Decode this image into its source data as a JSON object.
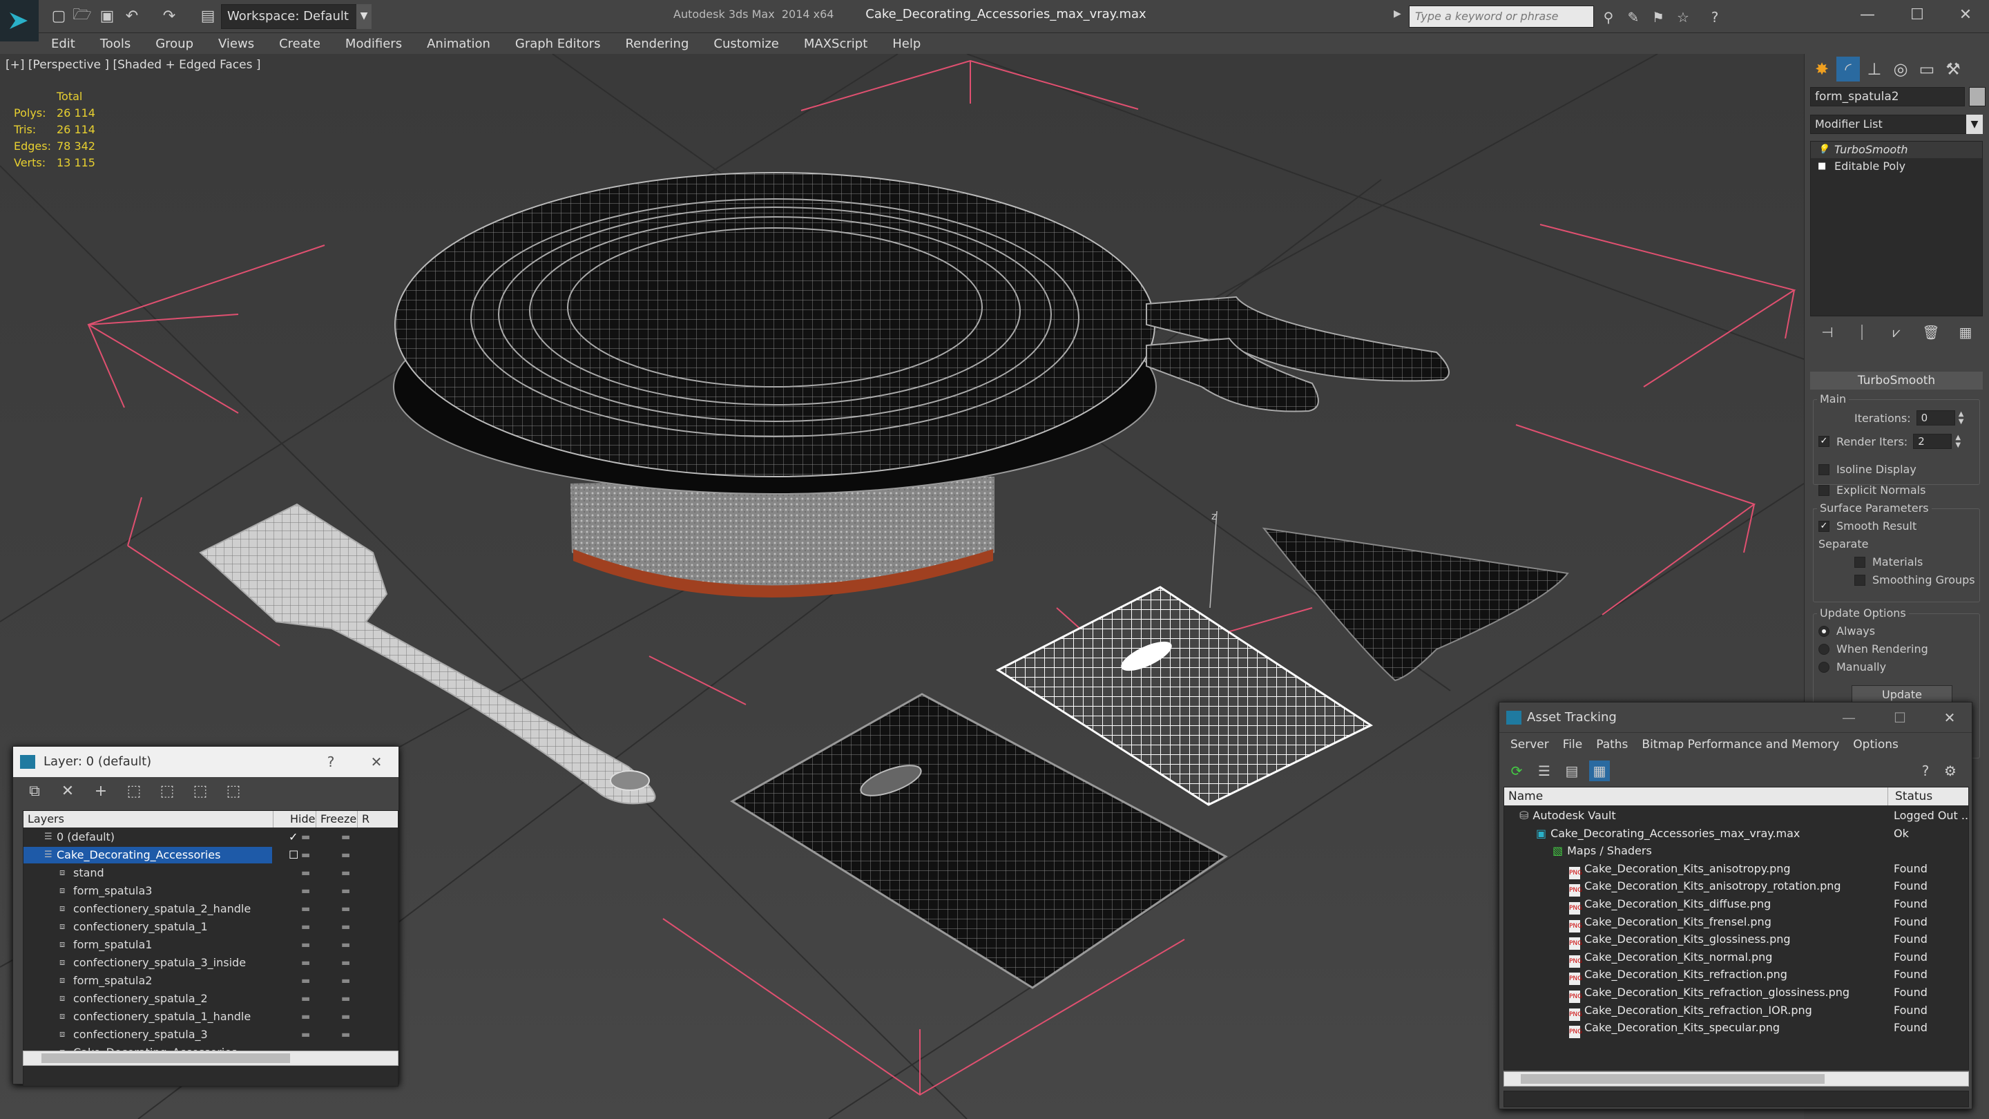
{
  "app": {
    "title": "Autodesk 3ds Max  2014 x64",
    "file": "Cake_Decorating_Accessories_max_vray.max",
    "workspace": "Workspace: Default",
    "search_placeholder": "Type a keyword or phrase"
  },
  "menu": [
    "Edit",
    "Tools",
    "Group",
    "Views",
    "Create",
    "Modifiers",
    "Animation",
    "Graph Editors",
    "Rendering",
    "Customize",
    "MAXScript",
    "Help"
  ],
  "viewport": {
    "label": "[+] [Perspective ] [Shaded + Edged Faces ]",
    "stats": {
      "header": "Total",
      "rows": [
        {
          "label": "Polys:",
          "value": "26 114"
        },
        {
          "label": "Tris:",
          "value": "26 114"
        },
        {
          "label": "Edges:",
          "value": "78 342"
        },
        {
          "label": "Verts:",
          "value": "13 115"
        }
      ]
    },
    "axis_label": "z"
  },
  "command_panel": {
    "object_name": "form_spatula2",
    "modifier_list": "Modifier List",
    "stack": [
      {
        "label": "TurboSmooth",
        "selected": true
      },
      {
        "label": "Editable Poly",
        "selected": false
      }
    ],
    "turbosmooth": {
      "title": "TurboSmooth",
      "main_label": "Main",
      "iterations_label": "Iterations:",
      "iterations_value": "0",
      "render_iters_label": "Render Iters:",
      "render_iters_value": "2",
      "isoline_label": "Isoline Display",
      "explicit_normals_label": "Explicit Normals",
      "surface_params_label": "Surface Parameters",
      "smooth_result_label": "Smooth Result",
      "separate_label": "Separate",
      "materials_label": "Materials",
      "smoothing_groups_label": "Smoothing Groups",
      "update_options_label": "Update Options",
      "always_label": "Always",
      "when_rendering_label": "When Rendering",
      "manually_label": "Manually",
      "update_button": "Update"
    }
  },
  "layer_dialog": {
    "title": "Layer: 0 (default)",
    "help": "?",
    "columns": [
      "Layers",
      "Hide",
      "Freeze",
      "R"
    ],
    "rows": [
      {
        "name": "0 (default)",
        "level": 0,
        "checked": true,
        "selected": false
      },
      {
        "name": "Cake_Decorating_Accessories",
        "level": 0,
        "checked": false,
        "selected": true
      },
      {
        "name": "stand",
        "level": 1
      },
      {
        "name": "form_spatula3",
        "level": 1
      },
      {
        "name": "confectionery_spatula_2_handle",
        "level": 1
      },
      {
        "name": "confectionery_spatula_1",
        "level": 1
      },
      {
        "name": "form_spatula1",
        "level": 1
      },
      {
        "name": "confectionery_spatula_3_inside",
        "level": 1
      },
      {
        "name": "form_spatula2",
        "level": 1
      },
      {
        "name": "confectionery_spatula_2",
        "level": 1
      },
      {
        "name": "confectionery_spatula_1_handle",
        "level": 1
      },
      {
        "name": "confectionery_spatula_3",
        "level": 1
      },
      {
        "name": "Cake_Decorating_Accessories",
        "level": 1
      }
    ]
  },
  "asset_tracking": {
    "title": "Asset Tracking",
    "menu": [
      "Server",
      "File",
      "Paths",
      "Bitmap Performance and Memory",
      "Options"
    ],
    "columns": [
      "Name",
      "Status"
    ],
    "rows": [
      {
        "name": "Autodesk Vault",
        "status": "Logged Out ...",
        "level": 0,
        "kind": "vault"
      },
      {
        "name": "Cake_Decorating_Accessories_max_vray.max",
        "status": "Ok",
        "level": 1,
        "kind": "max"
      },
      {
        "name": "Maps / Shaders",
        "status": "",
        "level": 2,
        "kind": "folder"
      },
      {
        "name": "Cake_Decoration_Kits_anisotropy.png",
        "status": "Found",
        "level": 3,
        "kind": "png"
      },
      {
        "name": "Cake_Decoration_Kits_anisotropy_rotation.png",
        "status": "Found",
        "level": 3,
        "kind": "png"
      },
      {
        "name": "Cake_Decoration_Kits_diffuse.png",
        "status": "Found",
        "level": 3,
        "kind": "png"
      },
      {
        "name": "Cake_Decoration_Kits_frensel.png",
        "status": "Found",
        "level": 3,
        "kind": "png"
      },
      {
        "name": "Cake_Decoration_Kits_glossiness.png",
        "status": "Found",
        "level": 3,
        "kind": "png"
      },
      {
        "name": "Cake_Decoration_Kits_normal.png",
        "status": "Found",
        "level": 3,
        "kind": "png"
      },
      {
        "name": "Cake_Decoration_Kits_refraction.png",
        "status": "Found",
        "level": 3,
        "kind": "png"
      },
      {
        "name": "Cake_Decoration_Kits_refraction_glossiness.png",
        "status": "Found",
        "level": 3,
        "kind": "png"
      },
      {
        "name": "Cake_Decoration_Kits_refraction_IOR.png",
        "status": "Found",
        "level": 3,
        "kind": "png"
      },
      {
        "name": "Cake_Decoration_Kits_specular.png",
        "status": "Found",
        "level": 3,
        "kind": "png"
      }
    ]
  },
  "colors": {
    "stats": "#e8d030",
    "selection": "#1e5aa8",
    "bbox_lines": "#e05070",
    "accent": "#1f7aa0"
  }
}
